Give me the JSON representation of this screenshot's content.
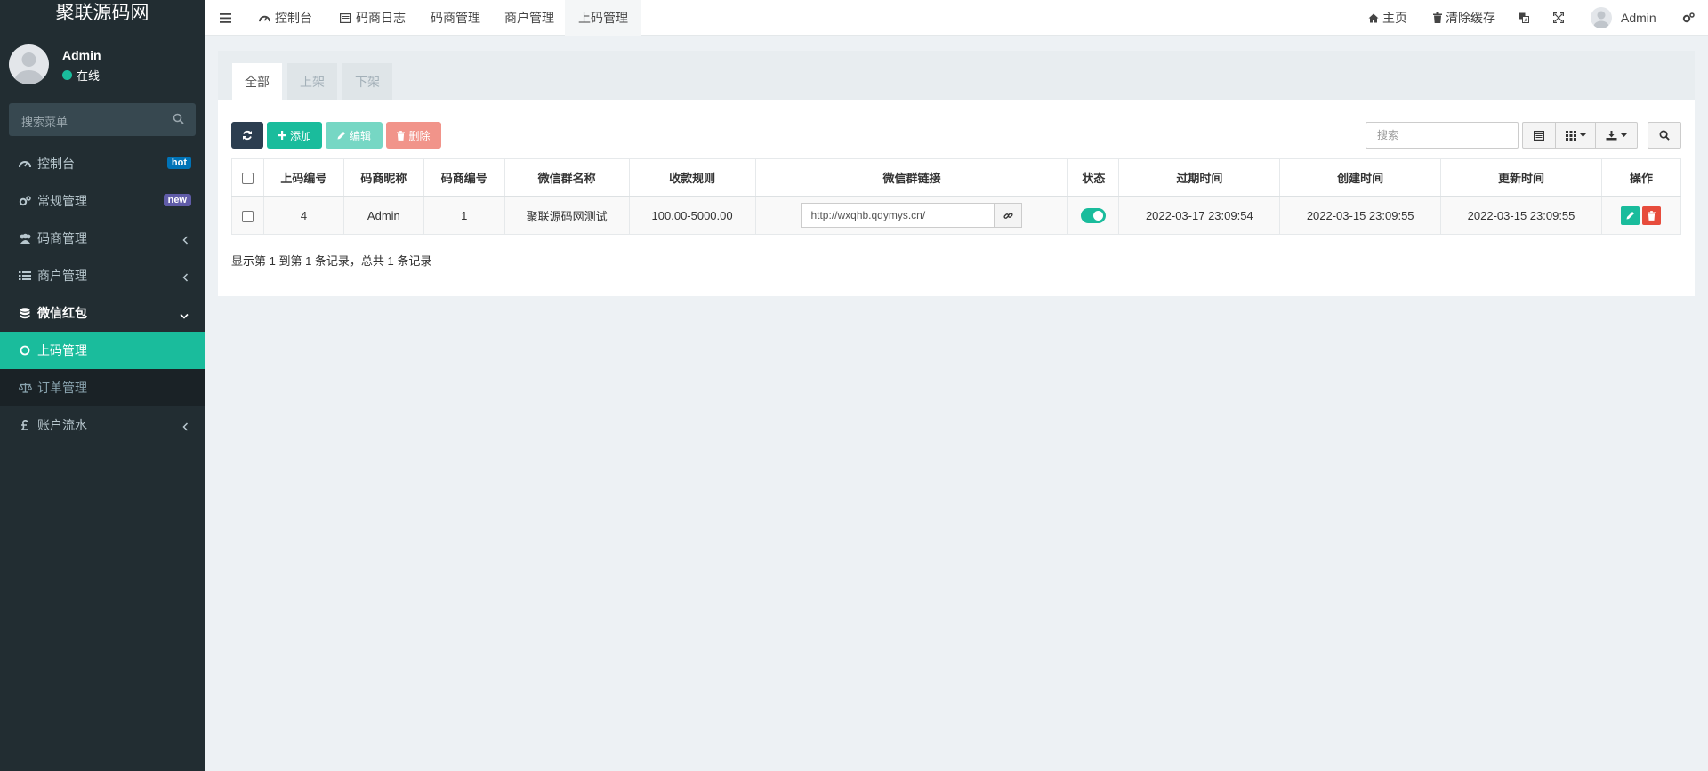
{
  "sidebar": {
    "brand": "聚联源码网",
    "user": {
      "name": "Admin",
      "status": "在线"
    },
    "search_placeholder": "搜索菜单",
    "items": [
      {
        "label": "控制台",
        "icon": "dashboard-icon",
        "badge": "hot",
        "badge_color": "#0073b7"
      },
      {
        "label": "常规管理",
        "icon": "cogs-icon",
        "badge": "new",
        "badge_color": "#605ca8"
      },
      {
        "label": "码商管理",
        "icon": "users-icon"
      },
      {
        "label": "商户管理",
        "icon": "list-icon"
      },
      {
        "label": "微信红包",
        "icon": "database-icon"
      },
      {
        "label": "上码管理",
        "icon": "circle-icon"
      },
      {
        "label": "订单管理",
        "icon": "balance-scale-icon"
      },
      {
        "label": "账户流水",
        "icon": "gbp-icon"
      }
    ]
  },
  "topnav": {
    "tabs": [
      {
        "label": "控制台",
        "icon": "dashboard-icon"
      },
      {
        "label": "码商日志",
        "icon": "list-alt-icon"
      },
      {
        "label": "码商管理"
      },
      {
        "label": "商户管理"
      },
      {
        "label": "上码管理"
      }
    ],
    "home": "主页",
    "clear_cache": "清除缓存",
    "admin": "Admin"
  },
  "panel": {
    "tabs": [
      "全部",
      "上架",
      "下架"
    ],
    "toolbar": {
      "add": "添加",
      "edit": "编辑",
      "delete": "删除"
    },
    "search_placeholder": "搜索",
    "table": {
      "headers": [
        "上码编号",
        "码商昵称",
        "码商编号",
        "微信群名称",
        "收款规则",
        "微信群链接",
        "状态",
        "过期时间",
        "创建时间",
        "更新时间",
        "操作"
      ],
      "rows": [
        {
          "id": "4",
          "nickname": "Admin",
          "merchant_no": "1",
          "group_name": "聚联源码网测试",
          "rule": "100.00-5000.00",
          "link": "http://wxqhb.qdymys.cn/",
          "expire": "2022-03-17 23:09:54",
          "created": "2022-03-15 23:09:55",
          "updated": "2022-03-15 23:09:55"
        }
      ]
    },
    "summary": "显示第 1 到第 1 条记录，总共 1 条记录"
  },
  "colors": {
    "accent": "#1abc9c",
    "sidebar": "#222d32",
    "danger": "#e74c3c"
  }
}
